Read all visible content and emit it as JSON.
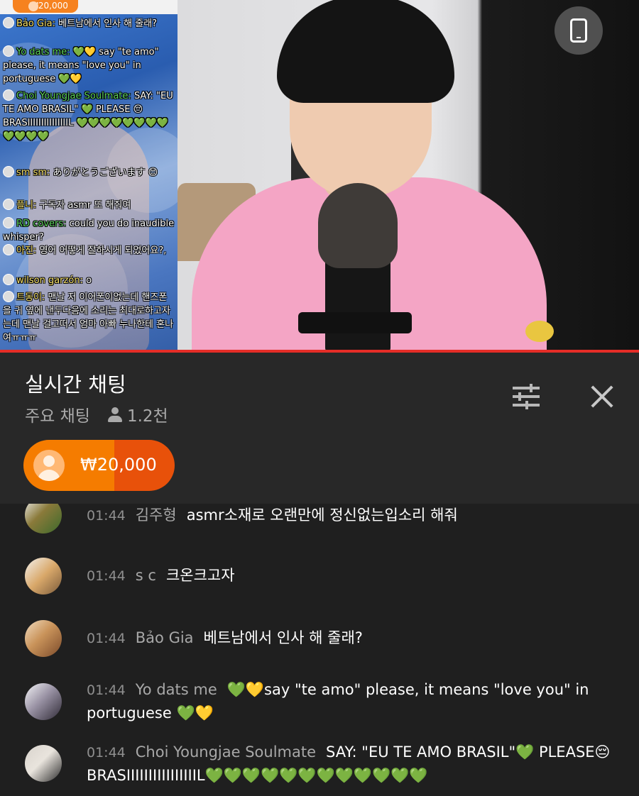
{
  "video": {
    "overlay_donation": "₩20,000",
    "overlay_chat": [
      {
        "author": "Bảo Gia:",
        "text": "베트남에서 인사 해 줄래?",
        "member": false
      },
      {
        "author": "Yo dats me:",
        "text": "💚💛 say \"te amo\" please, it means \"love you\" in portuguese 💚💛",
        "member": true
      },
      {
        "author": "Choi Youngjae Soulmate:",
        "text": "SAY: \"EU TE AMO BRASIL\" 💚 PLEASE 😔 BRASIIIIIIIIIIIIIIIL 💚💚💚💚💚💚💚💚💚💚💚💚",
        "member": true
      },
      {
        "author": "sm sm:",
        "text": "ありがとうございます 😊",
        "member": false
      },
      {
        "author": "플니:",
        "text": "구독자 asmr 또 해줘여",
        "member": false
      },
      {
        "author": "RD covers:",
        "text": "could you do inaudible whisper?",
        "member": true
      },
      {
        "author": "아진:",
        "text": "영어 어떻게 잘하시게 되었어요?,",
        "member": false
      },
      {
        "author": "wilson garzón:",
        "text": "o",
        "member": false
      },
      {
        "author": "트동이:",
        "text": "맨날 저 이어폰이없는데 핸즈폰을 귀 옆에 낸두다음에 소리는 최대로하고자는데 맨날 걸고떠서 엄마 아빠 누나한테 혼나여ㅠㅠㅠ",
        "member": false
      }
    ]
  },
  "chat": {
    "title": "실시간 채팅",
    "mode": "주요 채팅",
    "viewers": "1.2천",
    "superchat_amount": "₩20,000",
    "messages": [
      {
        "time": "01:44",
        "author": "김주형",
        "text": "asmr소재로 오랜만에 정신없는입소리 해줘"
      },
      {
        "time": "01:44",
        "author": "s c",
        "text": "크온크고자"
      },
      {
        "time": "01:44",
        "author": "Bảo Gia",
        "text": "베트남에서 인사 해 줄래?"
      },
      {
        "time": "01:44",
        "author": "Yo dats me",
        "text": "💚💛say \"te amo\" please, it means \"love you\" in portuguese 💚💛"
      },
      {
        "time": "01:44",
        "author": "Choi Youngjae Soulmate",
        "text": "SAY: \"EU TE AMO BRASIL\"💚 PLEASE😔BRASIIIIIIIIIIIIIIIIL💚💚💚💚💚💚💚💚💚💚💚💚"
      }
    ]
  },
  "colors": {
    "progress": "#e52d27",
    "superchat_main": "#f57c00",
    "superchat_right": "#e8510a",
    "header_bg": "#282828",
    "messages_bg": "#1f1f1f"
  },
  "icons": [
    "rotate-phone-icon",
    "viewer-icon",
    "filter-icon",
    "close-icon"
  ]
}
